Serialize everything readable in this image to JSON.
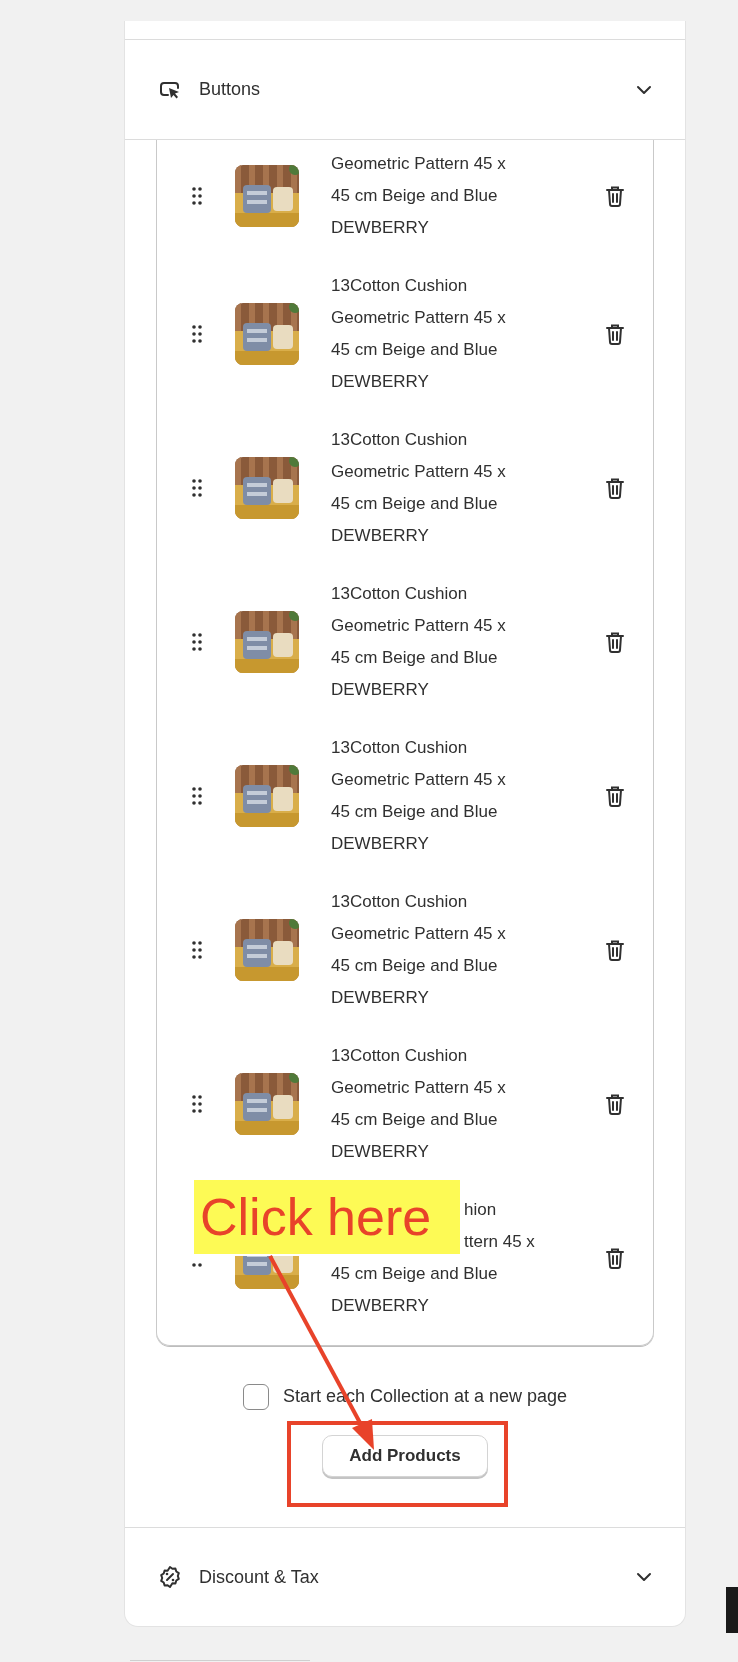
{
  "buttons_section": {
    "title": "Buttons",
    "expanded": false
  },
  "products": [
    {
      "lines": [
        "Geometric Pattern 45 x",
        "45 cm Beige and Blue",
        "DEWBERRY"
      ],
      "covered": false
    },
    {
      "lines": [
        "13Cotton Cushion",
        "Geometric Pattern 45 x",
        "45 cm Beige and Blue",
        "DEWBERRY"
      ],
      "covered": false
    },
    {
      "lines": [
        "13Cotton Cushion",
        "Geometric Pattern 45 x",
        "45 cm Beige and Blue",
        "DEWBERRY"
      ],
      "covered": false
    },
    {
      "lines": [
        "13Cotton Cushion",
        "Geometric Pattern 45 x",
        "45 cm Beige and Blue",
        "DEWBERRY"
      ],
      "covered": false
    },
    {
      "lines": [
        "13Cotton Cushion",
        "Geometric Pattern 45 x",
        "45 cm Beige and Blue",
        "DEWBERRY"
      ],
      "covered": false
    },
    {
      "lines": [
        "13Cotton Cushion",
        "Geometric Pattern 45 x",
        "45 cm Beige and Blue",
        "DEWBERRY"
      ],
      "covered": false
    },
    {
      "lines": [
        "13Cotton Cushion",
        "Geometric Pattern 45 x",
        "45 cm Beige and Blue",
        "DEWBERRY"
      ],
      "covered": false
    },
    {
      "lines": [
        "hion",
        "ttern 45 x",
        "45 cm Beige and Blue",
        "DEWBERRY"
      ],
      "covered": true
    }
  ],
  "new_page_option": {
    "label": "Start each Collection at a new page",
    "checked": false
  },
  "add_button": {
    "label": "Add Products"
  },
  "discount_section": {
    "title": "Discount & Tax",
    "expanded": false
  },
  "annotation": {
    "text": "Click here"
  }
}
